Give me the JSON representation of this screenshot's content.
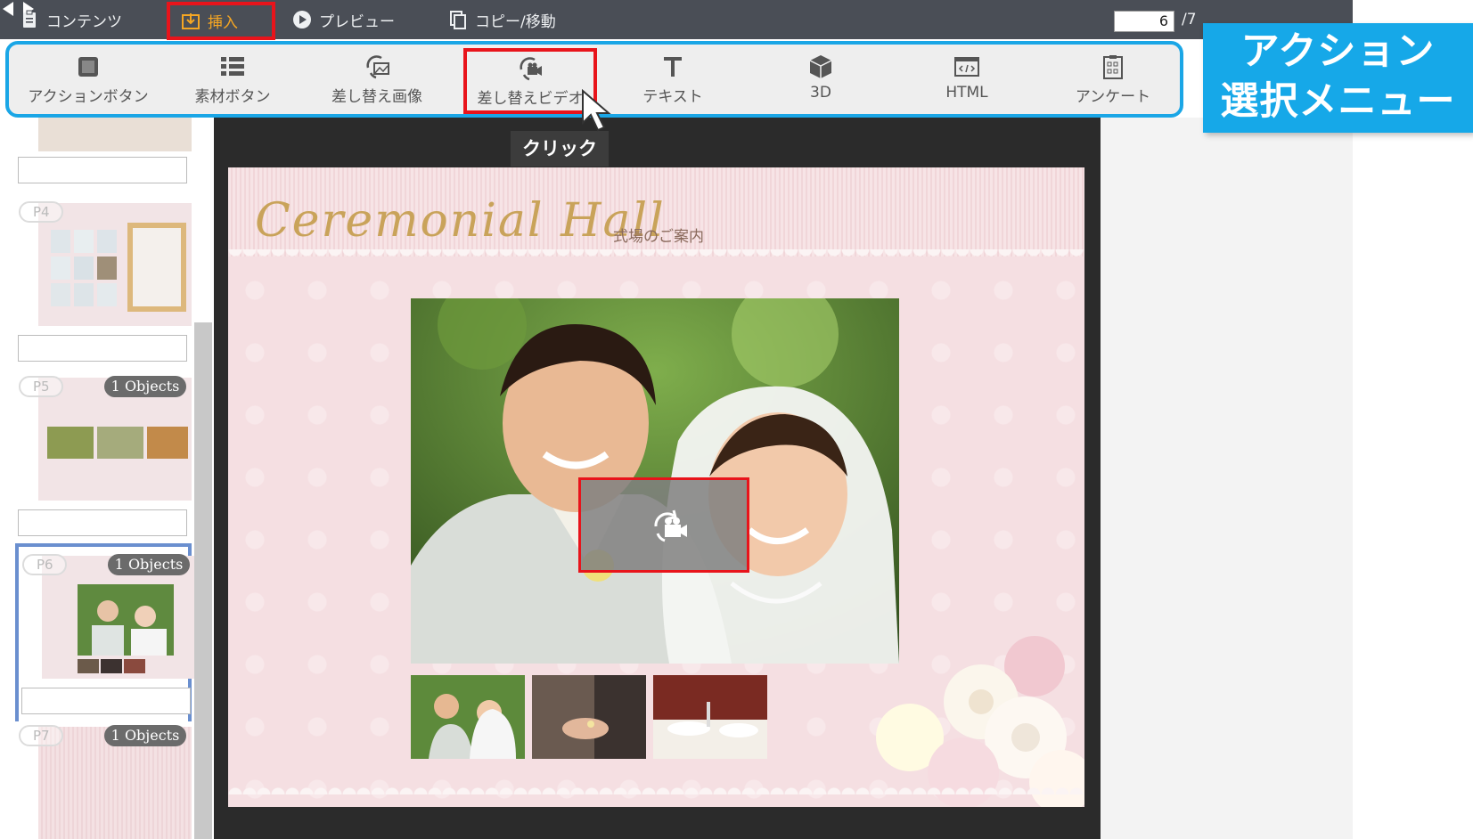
{
  "topbar": {
    "contents_label": "コンテンツ",
    "insert_label": "挿入",
    "preview_label": "プレビュー",
    "copy_move_label": "コピー/移動",
    "page_current": "6",
    "page_total": "/7"
  },
  "action_menu": {
    "items": [
      {
        "label": "アクションボタン",
        "icon": "square-button-icon"
      },
      {
        "label": "素材ボタン",
        "icon": "list-icon"
      },
      {
        "label": "差し替え画像",
        "icon": "image-replace-icon"
      },
      {
        "label": "差し替えビデオ",
        "icon": "video-replace-icon"
      },
      {
        "label": "テキスト",
        "icon": "text-icon"
      },
      {
        "label": "3D",
        "icon": "cube-icon"
      },
      {
        "label": "HTML",
        "icon": "html-icon"
      },
      {
        "label": "アンケート",
        "icon": "survey-icon"
      }
    ]
  },
  "callout": {
    "line1": "アクション",
    "line2": "選択メニュー"
  },
  "click_tooltip": "クリック",
  "thumbnails": [
    {
      "page": "P4",
      "objects": ""
    },
    {
      "page": "P5",
      "objects": "1 Objects"
    },
    {
      "page": "P6",
      "objects": "1 Objects"
    },
    {
      "page": "P7",
      "objects": "1 Objects"
    }
  ],
  "slide": {
    "title": "Ceremonial Hall",
    "subtitle": "式場のご案内"
  },
  "colors": {
    "accent_orange": "#f5a623",
    "highlight_red": "#e8141b",
    "callout_blue": "#16a8e8",
    "topbar_bg": "#4a4e56"
  }
}
